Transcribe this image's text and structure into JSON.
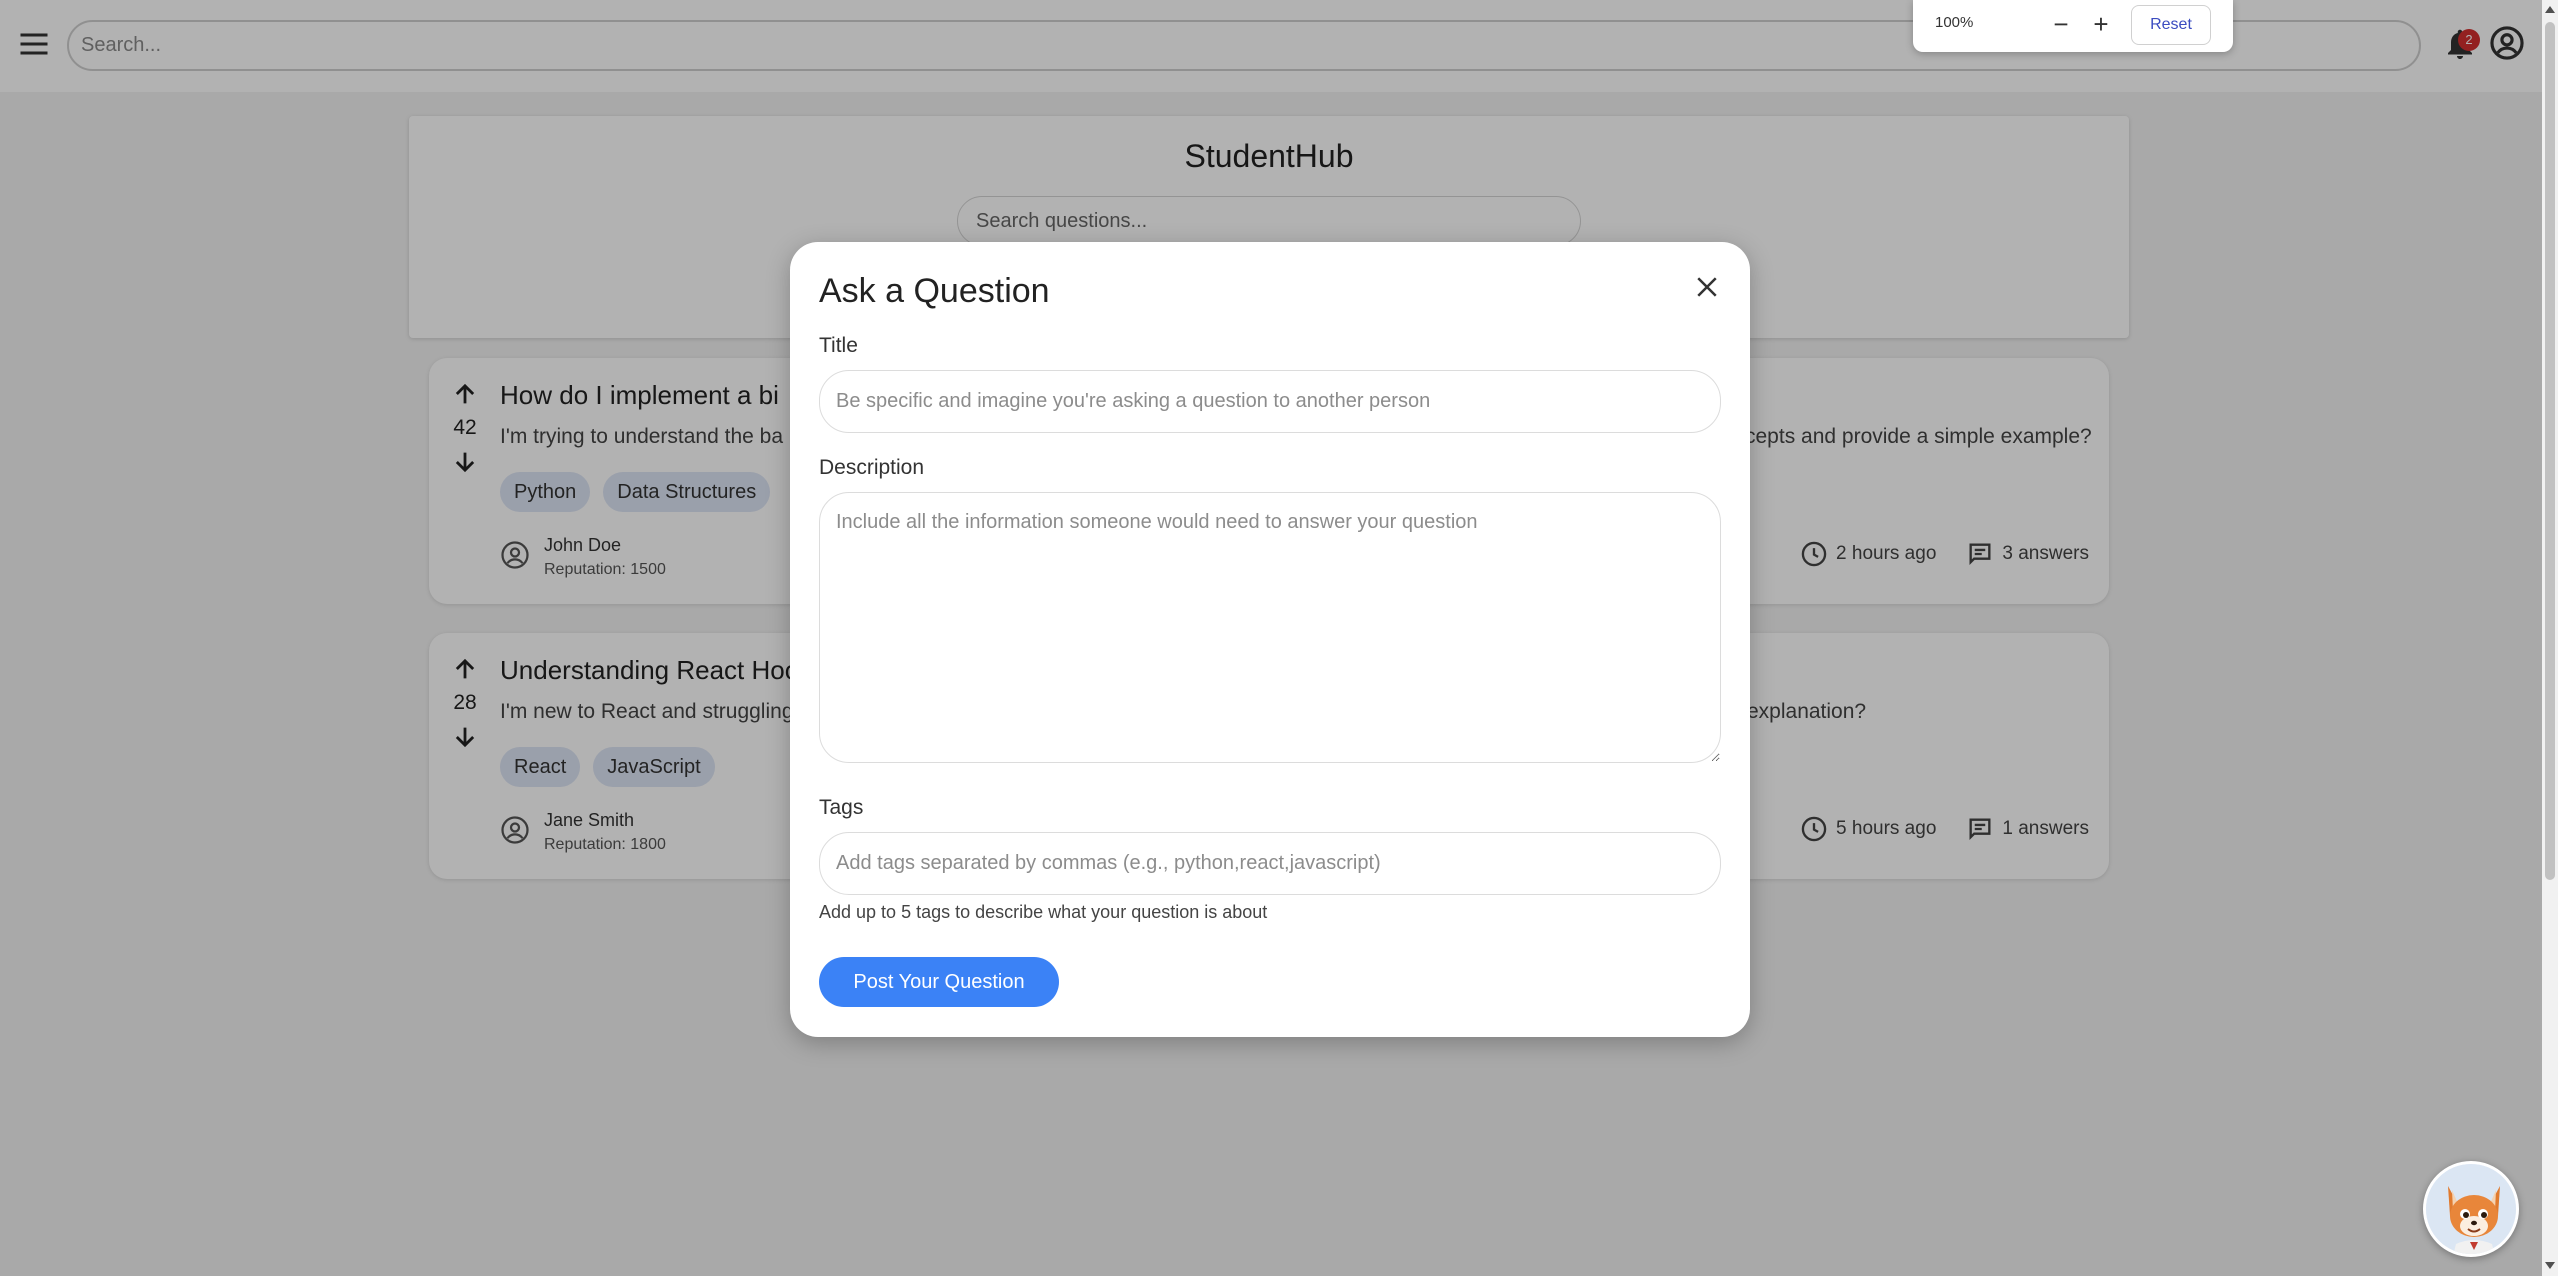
{
  "topbar": {
    "search_placeholder": "Search...",
    "notification_count": "2"
  },
  "zoom": {
    "level": "100%",
    "minus": "−",
    "plus": "+",
    "reset_label": "Reset"
  },
  "header": {
    "title": "StudentHub",
    "search_placeholder": "Search questions..."
  },
  "questions": [
    {
      "votes": "42",
      "title": "How do I implement a bi",
      "description_left": "I'm trying to understand the ba",
      "description_right": "cepts and provide a simple example?",
      "tags": [
        "Python",
        "Data Structures"
      ],
      "author": "John Doe",
      "reputation": "Reputation: 1500",
      "time": "2 hours ago",
      "answers": "3 answers"
    },
    {
      "votes": "28",
      "title": "Understanding React Hoo",
      "description_left": "I'm new to React and struggling",
      "description_right": "explanation?",
      "tags": [
        "React",
        "JavaScript"
      ],
      "author": "Jane Smith",
      "reputation": "Reputation: 1800",
      "time": "5 hours ago",
      "answers": "1 answers"
    }
  ],
  "modal": {
    "title": "Ask a Question",
    "title_label": "Title",
    "title_placeholder": "Be specific and imagine you're asking a question to another person",
    "description_label": "Description",
    "description_placeholder": "Include all the information someone would need to answer your question",
    "tags_label": "Tags",
    "tags_placeholder": "Add tags separated by commas (e.g., python,react,javascript)",
    "tags_help": "Add up to 5 tags to describe what your question is about",
    "submit_label": "Post Your Question"
  },
  "colors": {
    "primary": "#3b82f6",
    "tag_bg": "#dde5f5",
    "badge": "#d32f2f"
  }
}
